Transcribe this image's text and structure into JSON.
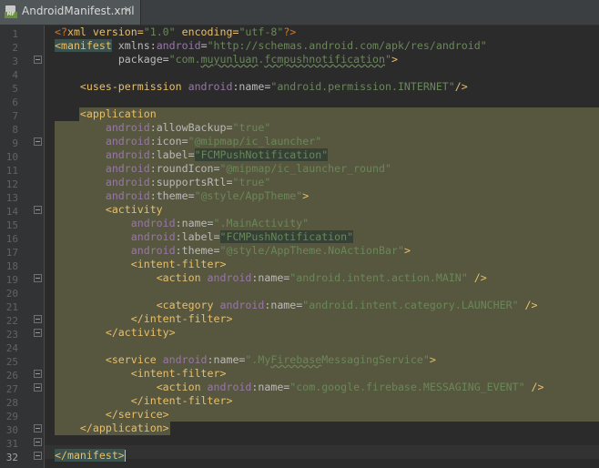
{
  "tab": {
    "label": "AndroidManifest.xml",
    "icon_badge": "MF",
    "close": "×"
  },
  "gutter": {
    "line_numbers": [
      "1",
      "2",
      "3",
      "4",
      "5",
      "6",
      "7",
      "8",
      "9",
      "10",
      "11",
      "12",
      "13",
      "14",
      "15",
      "16",
      "17",
      "18",
      "19",
      "20",
      "21",
      "22",
      "23",
      "24",
      "25",
      "26",
      "27",
      "28",
      "29",
      "30",
      "31",
      "32"
    ],
    "current_line": "32"
  },
  "code": {
    "l1": {
      "a": "<?",
      "b": "xml version=",
      "c": "\"1.0\"",
      "d": " encoding=",
      "e": "\"utf-8\"",
      "f": "?>"
    },
    "l2": {
      "tag": "<manifest",
      "xmlns": " xmlns",
      "colon": ":",
      "android": "android",
      "eq": "=",
      "val": "\"http://schemas.android.com/apk/res/android\""
    },
    "l3": {
      "attr": "package=",
      "q1": "\"com.",
      "p1": "muyunluan",
      "dot": ".",
      "p2": "fcmpushnotification",
      "q2": "\"",
      "end": ">"
    },
    "l5": {
      "tag": "<uses-permission",
      "ns": " android",
      "attr": ":name=",
      "val": "\"android.permission.INTERNET\"",
      "end": "/>"
    },
    "l7": {
      "tag": "<application"
    },
    "l8": {
      "ns": "android",
      "attr": ":allowBackup=",
      "val": "\"true\""
    },
    "l9": {
      "ns": "android",
      "attr": ":icon=",
      "val": "\"@mipmap/ic_launcher\""
    },
    "l10": {
      "ns": "android",
      "attr": ":label=",
      "val": "\"FCMPushNotification\""
    },
    "l11": {
      "ns": "android",
      "attr": ":roundIcon=",
      "val": "\"@mipmap/ic_launcher_round\""
    },
    "l12": {
      "ns": "android",
      "attr": ":supportsRtl=",
      "val": "\"true\""
    },
    "l13": {
      "ns": "android",
      "attr": ":theme=",
      "val": "\"@style/AppTheme\"",
      "end": ">"
    },
    "l14": {
      "tag": "<activity"
    },
    "l15": {
      "ns": "android",
      "attr": ":name=",
      "val": "\".MainActivity\""
    },
    "l16": {
      "ns": "android",
      "attr": ":label=",
      "val": "\"FCMPushNotification\""
    },
    "l17": {
      "ns": "android",
      "attr": ":theme=",
      "val": "\"@style/AppTheme.NoActionBar\"",
      "end": ">"
    },
    "l18": {
      "tag": "<intent-filter>"
    },
    "l19": {
      "tag": "<action",
      "ns": " android",
      "attr": ":name=",
      "val": "\"android.intent.action.MAIN\"",
      "end": " />"
    },
    "l21": {
      "tag": "<category",
      "ns": " android",
      "attr": ":name=",
      "val": "\"android.intent.category.LAUNCHER\"",
      "end": " />"
    },
    "l22": {
      "tag": "</intent-filter>"
    },
    "l23": {
      "tag": "</activity>"
    },
    "l25": {
      "tag": "<service",
      "ns": " android",
      "attr": ":name=",
      "q1": "\".My",
      "sq": "Firebase",
      "rest": "MessagingService\"",
      "end": ">"
    },
    "l26": {
      "tag": "<intent-filter>"
    },
    "l27": {
      "tag": "<action",
      "ns": " android",
      "attr": ":name=",
      "val": "\"com.google.firebase.MESSAGING_EVENT\"",
      "end": " />"
    },
    "l28": {
      "tag": "</intent-filter>"
    },
    "l29": {
      "tag": "</service>"
    },
    "l30": {
      "tag": "</application>"
    },
    "l32": {
      "tag": "</manifest>"
    }
  },
  "colors": {
    "background": "#2b2b2b",
    "tag": "#e8bf6a",
    "namespace": "#9876aa",
    "string": "#6a8759",
    "highlight": "#57573f"
  }
}
